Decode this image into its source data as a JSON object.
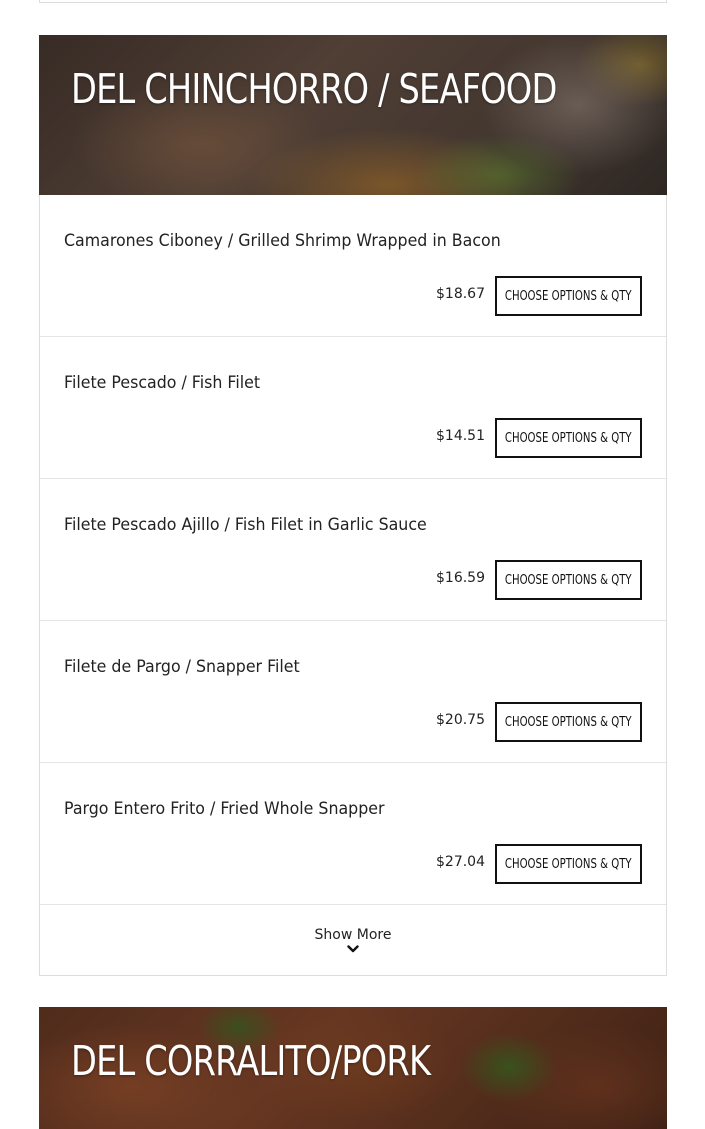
{
  "sections": [
    {
      "title": "DEL CHINCHORRO / SEAFOOD",
      "items": [
        {
          "name": "Camarones Ciboney / Grilled Shrimp Wrapped in Bacon",
          "price": "$18.67",
          "button": "CHOOSE OPTIONS & QTY"
        },
        {
          "name": "Filete Pescado / Fish Filet",
          "price": "$14.51",
          "button": "CHOOSE OPTIONS & QTY"
        },
        {
          "name": "Filete Pescado Ajillo / Fish Filet in Garlic Sauce",
          "price": "$16.59",
          "button": "CHOOSE OPTIONS & QTY"
        },
        {
          "name": "Filete de Pargo / Snapper Filet",
          "price": "$20.75",
          "button": "CHOOSE OPTIONS & QTY"
        },
        {
          "name": "Pargo Entero Frito / Fried Whole Snapper",
          "price": "$27.04",
          "button": "CHOOSE OPTIONS & QTY"
        }
      ],
      "show_more": "Show More"
    },
    {
      "title": "DEL CORRALITO/PORK"
    }
  ],
  "icons": {
    "show_more": "chevron-down-icon"
  }
}
